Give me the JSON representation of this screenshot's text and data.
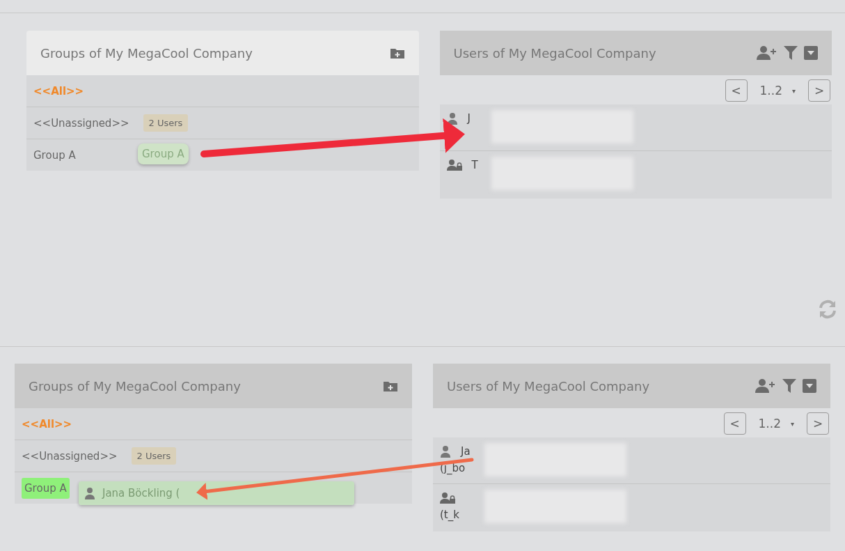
{
  "sections": [
    {
      "groups_panel": {
        "title": "Groups of My MegaCool Company",
        "highlighted": true,
        "items": [
          {
            "label": "<<All>>",
            "selected": true
          },
          {
            "label": "<<Unassigned>>",
            "badge": "2 Users",
            "selected": false,
            "drop_target": false
          },
          {
            "label": "Group A",
            "selected": false,
            "drop_target": false
          }
        ]
      },
      "drag_ghost": {
        "kind": "group",
        "label": "Group A"
      },
      "users_panel": {
        "title": "Users of My MegaCool Company",
        "pager": {
          "prev": "<",
          "page": "1..2",
          "caret": "▾",
          "next": ">"
        },
        "users": [
          {
            "kind": "user",
            "name": "J"
          },
          {
            "kind": "admin",
            "name": "T"
          }
        ]
      },
      "tools": [
        {
          "kind": "refresh"
        }
      ]
    },
    {
      "groups_panel": {
        "title": "Groups of My MegaCool Company",
        "highlighted": false,
        "items": [
          {
            "label": "<<All>>",
            "selected": true
          },
          {
            "label": "<<Unassigned>>",
            "badge": "2 Users",
            "selected": false,
            "drop_target": false
          },
          {
            "label": "Group A",
            "selected": false,
            "drop_target": true
          }
        ]
      },
      "drag_ghost": {
        "kind": "user",
        "label": "Jana Böckling ("
      },
      "users_panel": {
        "title": "Users of My MegaCool Company",
        "pager": {
          "prev": "<",
          "page": "1..2",
          "caret": "▾",
          "next": ">"
        },
        "users": [
          {
            "kind": "user",
            "name": "Ja",
            "login": "(j_bo"
          },
          {
            "kind": "admin",
            "login": "(t_k"
          }
        ]
      }
    }
  ]
}
